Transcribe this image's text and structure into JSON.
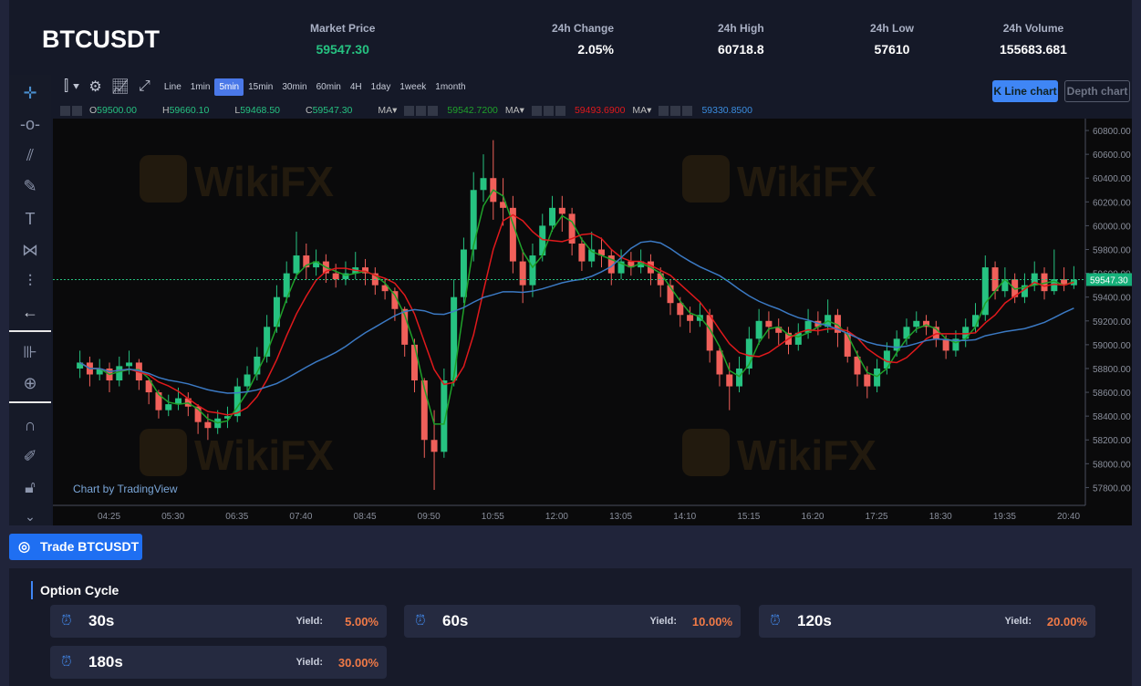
{
  "header": {
    "symbol": "BTCUSDT",
    "stats": [
      {
        "label": "Market Price",
        "value": "59547.30",
        "color": "#26c281"
      },
      {
        "label": "24h Change",
        "value": "2.05%"
      },
      {
        "label": "24h High",
        "value": "60718.8"
      },
      {
        "label": "24h Low",
        "value": "57610"
      },
      {
        "label": "24h Volume",
        "value": "155683.681"
      }
    ]
  },
  "toolbar": {
    "intervals": [
      "Line",
      "1min",
      "5min",
      "15min",
      "30min",
      "60min",
      "4H",
      "1day",
      "1week",
      "1month"
    ],
    "active": "5min",
    "kline_label": "K Line chart",
    "depth_label": "Depth chart"
  },
  "legend": {
    "o": "O",
    "o_val": "59500.00",
    "h": "H",
    "h_val": "59660.10",
    "l": "L",
    "l_val": "59468.50",
    "c": "C",
    "c_val": "59547.30",
    "ma_label": "MA▾",
    "ma1": "59542.7200",
    "ma2": "59493.6900",
    "ma3": "59330.8500"
  },
  "colors": {
    "up": "#26c281",
    "down": "#f0605a",
    "ma1": "#1fa12a",
    "ma2": "#e0191c",
    "ma3": "#3b79c3"
  },
  "chart_data": {
    "type": "candlestick",
    "interval": "5min",
    "start_time": "03:55",
    "step_minutes": 10,
    "first_open": 58800,
    "close": [
      58850,
      58750,
      58800,
      58700,
      58820,
      58850,
      58700,
      58600,
      58450,
      58500,
      58550,
      58480,
      58350,
      58300,
      58380,
      58400,
      58650,
      58750,
      58900,
      59150,
      59400,
      59600,
      59750,
      59650,
      59700,
      59600,
      59550,
      59600,
      59650,
      59600,
      59500,
      59450,
      59300,
      59000,
      58700,
      58200,
      58100,
      58700,
      59400,
      59800,
      60300,
      60400,
      60200,
      60150,
      59700,
      59500,
      59750,
      60000,
      60150,
      60100,
      59850,
      59700,
      59800,
      59750,
      59600,
      59700,
      59650,
      59700,
      59600,
      59500,
      59350,
      59250,
      59200,
      59250,
      58950,
      58750,
      58650,
      58800,
      59050,
      59200,
      59150,
      59100,
      59000,
      59100,
      59200,
      59150,
      59250,
      59100,
      58900,
      58750,
      58650,
      58800,
      58950,
      59050,
      59150,
      59200,
      59150,
      59050,
      58950,
      59050,
      59150,
      59250,
      59650,
      59450,
      59550,
      59400,
      59500,
      59600,
      59450,
      59550,
      59500,
      59547.3
    ],
    "high": [
      58950,
      58900,
      58880,
      58850,
      58900,
      58950,
      58880,
      58720,
      58620,
      58580,
      58640,
      58600,
      58500,
      58420,
      58450,
      58480,
      58720,
      58820,
      58980,
      59250,
      59500,
      59700,
      59950,
      59850,
      59800,
      59760,
      59680,
      59700,
      59780,
      59720,
      59650,
      59560,
      59480,
      59320,
      59050,
      58720,
      58450,
      58800,
      59550,
      59900,
      60450,
      60600,
      60718.8,
      60400,
      60250,
      59800,
      59850,
      60100,
      60250,
      60250,
      60150,
      59900,
      59950,
      59900,
      59800,
      59800,
      59780,
      59800,
      59760,
      59650,
      59550,
      59400,
      59320,
      59350,
      59300,
      58980,
      58850,
      58900,
      59150,
      59300,
      59280,
      59220,
      59150,
      59180,
      59300,
      59280,
      59380,
      59300,
      59150,
      58950,
      58820,
      58880,
      59020,
      59120,
      59220,
      59280,
      59250,
      59200,
      59080,
      59120,
      59220,
      59350,
      59750,
      59700,
      59650,
      59600,
      59600,
      59700,
      59650,
      59800,
      59650,
      59660.1
    ],
    "low": [
      58720,
      58650,
      58700,
      58600,
      58650,
      58750,
      58620,
      58500,
      58380,
      58400,
      58450,
      58400,
      58250,
      58200,
      58250,
      58300,
      58350,
      58600,
      58700,
      58850,
      59100,
      59350,
      59550,
      59550,
      59580,
      59520,
      59480,
      59500,
      59550,
      59500,
      59420,
      59380,
      59200,
      58900,
      58600,
      58050,
      57780,
      58050,
      58650,
      59350,
      59700,
      60200,
      60050,
      60000,
      59600,
      59350,
      59400,
      59700,
      59950,
      59950,
      59750,
      59620,
      59650,
      59650,
      59500,
      59550,
      59580,
      59600,
      59500,
      59400,
      59250,
      59150,
      59100,
      59150,
      58850,
      58650,
      58450,
      58600,
      58750,
      59000,
      59050,
      59000,
      58920,
      58950,
      59050,
      59080,
      59100,
      58980,
      58850,
      58650,
      58550,
      58600,
      58750,
      58900,
      59000,
      59100,
      59080,
      58980,
      58880,
      58900,
      58980,
      59100,
      59200,
      59380,
      59400,
      59350,
      59350,
      59450,
      59380,
      59420,
      59450,
      59468.5
    ],
    "ylim": [
      57650,
      60900
    ],
    "y_ticks": [
      "60800.00",
      "60600.00",
      "60400.00",
      "60200.00",
      "60000.00",
      "59800.00",
      "59600.00",
      "59400.00",
      "59200.00",
      "59000.00",
      "58800.00",
      "58600.00",
      "58400.00",
      "58200.00",
      "58000.00",
      "57800.00"
    ],
    "x_ticks": [
      "04:25",
      "05:30",
      "06:35",
      "07:40",
      "08:45",
      "09:50",
      "10:55",
      "12:00",
      "13:05",
      "14:10",
      "15:15",
      "16:20",
      "17:25",
      "18:30",
      "19:35",
      "20:40"
    ],
    "last_price_label": "59547.30",
    "watermark": "WikiFX",
    "attribution": "Chart by TradingView"
  },
  "trade_button": "Trade BTCUSDT",
  "options": {
    "title": "Option Cycle",
    "yield_label": "Yield:",
    "items": [
      {
        "duration": "30s",
        "yield": "5.00%"
      },
      {
        "duration": "60s",
        "yield": "10.00%"
      },
      {
        "duration": "120s",
        "yield": "20.00%"
      },
      {
        "duration": "180s",
        "yield": "30.00%"
      }
    ]
  }
}
